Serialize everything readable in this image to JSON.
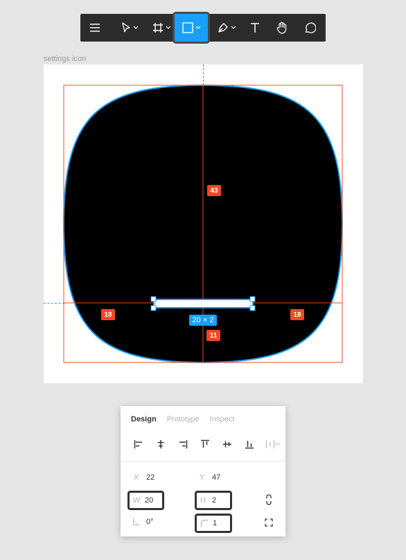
{
  "toolbar": {
    "tools": [
      "menu",
      "move",
      "frame",
      "rectangle",
      "pen",
      "text",
      "hand",
      "comment"
    ],
    "active_tool": "rectangle",
    "accent": "#18a0fb"
  },
  "canvas": {
    "frame_label": "settings icon",
    "shape_fill": "#000000",
    "shape_stroke": "#18a0fb",
    "measure_color": "#f24822",
    "measurements": {
      "top": "43",
      "left": "18",
      "right": "18",
      "bottom": "11"
    },
    "selection_size": "20 × 2"
  },
  "panel": {
    "tabs": [
      "Design",
      "Prototype",
      "Inspect"
    ],
    "active_tab": "Design",
    "x_label": "X",
    "x_value": "22",
    "y_label": "Y",
    "y_value": "47",
    "w_label": "W",
    "w_value": "20",
    "h_label": "H",
    "h_value": "2",
    "rotation_value": "0°",
    "radius_value": "1"
  }
}
